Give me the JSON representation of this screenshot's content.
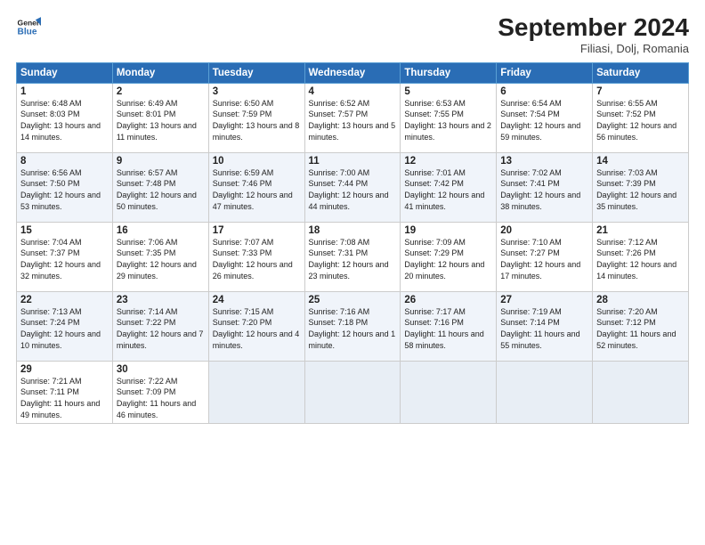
{
  "header": {
    "logo_line1": "General",
    "logo_line2": "Blue",
    "month": "September 2024",
    "location": "Filiasi, Dolj, Romania"
  },
  "days_of_week": [
    "Sunday",
    "Monday",
    "Tuesday",
    "Wednesday",
    "Thursday",
    "Friday",
    "Saturday"
  ],
  "weeks": [
    [
      {
        "num": "1",
        "sunrise": "6:48 AM",
        "sunset": "8:03 PM",
        "daylight": "13 hours and 14 minutes."
      },
      {
        "num": "2",
        "sunrise": "6:49 AM",
        "sunset": "8:01 PM",
        "daylight": "13 hours and 11 minutes."
      },
      {
        "num": "3",
        "sunrise": "6:50 AM",
        "sunset": "7:59 PM",
        "daylight": "13 hours and 8 minutes."
      },
      {
        "num": "4",
        "sunrise": "6:52 AM",
        "sunset": "7:57 PM",
        "daylight": "13 hours and 5 minutes."
      },
      {
        "num": "5",
        "sunrise": "6:53 AM",
        "sunset": "7:55 PM",
        "daylight": "13 hours and 2 minutes."
      },
      {
        "num": "6",
        "sunrise": "6:54 AM",
        "sunset": "7:54 PM",
        "daylight": "12 hours and 59 minutes."
      },
      {
        "num": "7",
        "sunrise": "6:55 AM",
        "sunset": "7:52 PM",
        "daylight": "12 hours and 56 minutes."
      }
    ],
    [
      {
        "num": "8",
        "sunrise": "6:56 AM",
        "sunset": "7:50 PM",
        "daylight": "12 hours and 53 minutes."
      },
      {
        "num": "9",
        "sunrise": "6:57 AM",
        "sunset": "7:48 PM",
        "daylight": "12 hours and 50 minutes."
      },
      {
        "num": "10",
        "sunrise": "6:59 AM",
        "sunset": "7:46 PM",
        "daylight": "12 hours and 47 minutes."
      },
      {
        "num": "11",
        "sunrise": "7:00 AM",
        "sunset": "7:44 PM",
        "daylight": "12 hours and 44 minutes."
      },
      {
        "num": "12",
        "sunrise": "7:01 AM",
        "sunset": "7:42 PM",
        "daylight": "12 hours and 41 minutes."
      },
      {
        "num": "13",
        "sunrise": "7:02 AM",
        "sunset": "7:41 PM",
        "daylight": "12 hours and 38 minutes."
      },
      {
        "num": "14",
        "sunrise": "7:03 AM",
        "sunset": "7:39 PM",
        "daylight": "12 hours and 35 minutes."
      }
    ],
    [
      {
        "num": "15",
        "sunrise": "7:04 AM",
        "sunset": "7:37 PM",
        "daylight": "12 hours and 32 minutes."
      },
      {
        "num": "16",
        "sunrise": "7:06 AM",
        "sunset": "7:35 PM",
        "daylight": "12 hours and 29 minutes."
      },
      {
        "num": "17",
        "sunrise": "7:07 AM",
        "sunset": "7:33 PM",
        "daylight": "12 hours and 26 minutes."
      },
      {
        "num": "18",
        "sunrise": "7:08 AM",
        "sunset": "7:31 PM",
        "daylight": "12 hours and 23 minutes."
      },
      {
        "num": "19",
        "sunrise": "7:09 AM",
        "sunset": "7:29 PM",
        "daylight": "12 hours and 20 minutes."
      },
      {
        "num": "20",
        "sunrise": "7:10 AM",
        "sunset": "7:27 PM",
        "daylight": "12 hours and 17 minutes."
      },
      {
        "num": "21",
        "sunrise": "7:12 AM",
        "sunset": "7:26 PM",
        "daylight": "12 hours and 14 minutes."
      }
    ],
    [
      {
        "num": "22",
        "sunrise": "7:13 AM",
        "sunset": "7:24 PM",
        "daylight": "12 hours and 10 minutes."
      },
      {
        "num": "23",
        "sunrise": "7:14 AM",
        "sunset": "7:22 PM",
        "daylight": "12 hours and 7 minutes."
      },
      {
        "num": "24",
        "sunrise": "7:15 AM",
        "sunset": "7:20 PM",
        "daylight": "12 hours and 4 minutes."
      },
      {
        "num": "25",
        "sunrise": "7:16 AM",
        "sunset": "7:18 PM",
        "daylight": "12 hours and 1 minute."
      },
      {
        "num": "26",
        "sunrise": "7:17 AM",
        "sunset": "7:16 PM",
        "daylight": "11 hours and 58 minutes."
      },
      {
        "num": "27",
        "sunrise": "7:19 AM",
        "sunset": "7:14 PM",
        "daylight": "11 hours and 55 minutes."
      },
      {
        "num": "28",
        "sunrise": "7:20 AM",
        "sunset": "7:12 PM",
        "daylight": "11 hours and 52 minutes."
      }
    ],
    [
      {
        "num": "29",
        "sunrise": "7:21 AM",
        "sunset": "7:11 PM",
        "daylight": "11 hours and 49 minutes."
      },
      {
        "num": "30",
        "sunrise": "7:22 AM",
        "sunset": "7:09 PM",
        "daylight": "11 hours and 46 minutes."
      },
      null,
      null,
      null,
      null,
      null
    ]
  ]
}
